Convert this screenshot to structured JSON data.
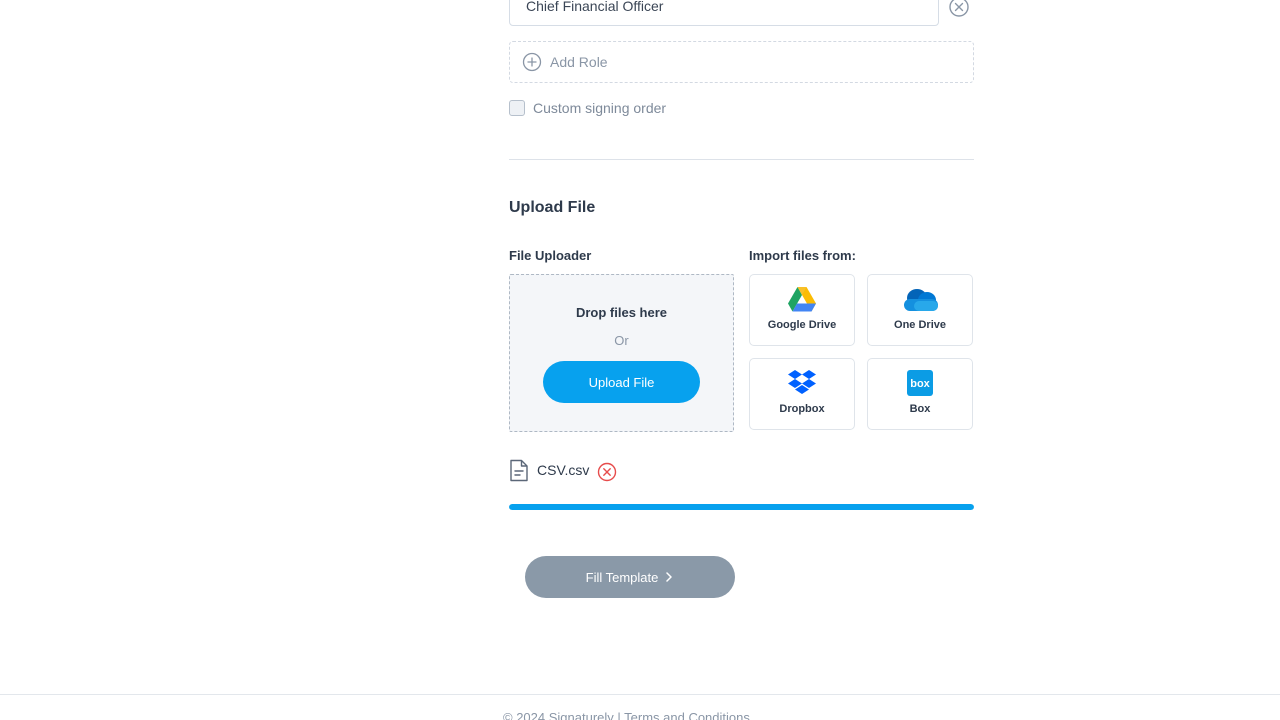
{
  "roles": {
    "current_role_value": "Chief Financial Officer",
    "add_role_label": "Add Role",
    "custom_signing_order_label": "Custom signing order"
  },
  "upload": {
    "section_title": "Upload File",
    "uploader_label": "File Uploader",
    "drop_text": "Drop files here",
    "or_text": "Or",
    "upload_button_label": "Upload File",
    "import_label": "Import files from:",
    "providers": [
      {
        "label": "Google Drive",
        "icon": "google-drive-icon"
      },
      {
        "label": "One Drive",
        "icon": "onedrive-icon"
      },
      {
        "label": "Dropbox",
        "icon": "dropbox-icon"
      },
      {
        "label": "Box",
        "icon": "box-icon"
      }
    ],
    "file": {
      "name": "CSV.csv",
      "progress_percent": 100
    }
  },
  "actions": {
    "fill_template_label": "Fill Template"
  },
  "footer": {
    "copyright": "© 2024 Signaturely |",
    "terms_label": "Terms and Conditions"
  },
  "colors": {
    "accent": "#07a1ee",
    "disabled_button": "#8a99a8",
    "remove_red": "#e74c4c"
  }
}
